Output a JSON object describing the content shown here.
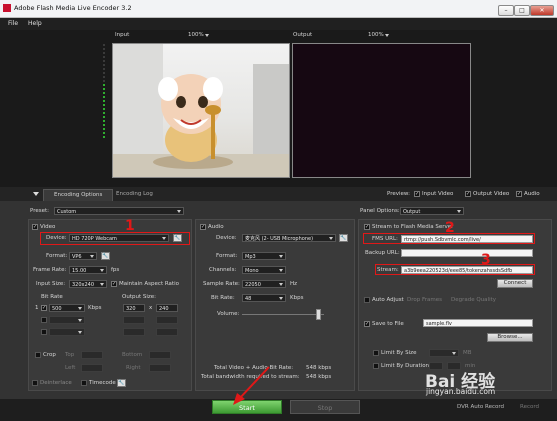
{
  "window": {
    "title": "Adobe Flash Media Live Encoder 3.2",
    "min": "–",
    "max": "□",
    "close": "✕"
  },
  "menu": {
    "file": "File",
    "help": "Help"
  },
  "preview": {
    "input_label": "Input",
    "input_zoom": "100%",
    "output_label": "Output",
    "output_zoom": "100%"
  },
  "tabs": {
    "options": "Encoding Options",
    "log": "Encoding Log"
  },
  "preview_opts": {
    "label": "Preview:",
    "input_video": "Input Video",
    "output_video": "Output Video",
    "audio": "Audio"
  },
  "preset": {
    "label": "Preset:",
    "value": "Custom"
  },
  "panel_options": {
    "label": "Panel Options:",
    "value": "Output"
  },
  "video": {
    "section_label": "Video",
    "device_label": "Device:",
    "device_value": "HD 720P Webcam",
    "format_label": "Format:",
    "format_value": "VP6",
    "frame_rate_label": "Frame Rate:",
    "frame_rate_value": "15.00",
    "fps_unit": "fps",
    "input_size_label": "Input Size:",
    "input_size_value": "320x240",
    "maintain_aspect": "Maintain Aspect Ratio",
    "bitrate_header": "Bit Rate",
    "output_size_header": "Output Size:",
    "row_index": "1",
    "bitrate_value": "500",
    "kbps": "Kbps",
    "out_w": "320",
    "out_h": "240",
    "x_sep": "x",
    "crop_label": "Crop",
    "top_label": "Top",
    "bottom_label": "Bottom",
    "left_label": "Left",
    "right_label": "Right",
    "deinterlace": "Deinterlace",
    "timecode": "Timecode"
  },
  "audio": {
    "section_label": "Audio",
    "device_label": "Device:",
    "device_value": "麦克风 (2- USB Microphone)",
    "format_label": "Format:",
    "format_value": "Mp3",
    "channels_label": "Channels:",
    "channels_value": "Mono",
    "sample_rate_label": "Sample Rate:",
    "sample_rate_value": "22050",
    "hz": "Hz",
    "bitrate_label": "Bit Rate:",
    "bitrate_value": "48",
    "kbps": "Kbps",
    "volume_label": "Volume:"
  },
  "totals": {
    "line1_label": "Total Video + Audio Bit Rate:",
    "line1_value": "548 kbps",
    "line2_label": "Total bandwidth required to stream:",
    "line2_value": "548 kbps"
  },
  "stream": {
    "stream_to_fms": "Stream to Flash Media Server",
    "fms_url_label": "FMS URL:",
    "fms_url_value": "rtmp://push.Sdbvmlc.com/live/",
    "backup_url_label": "Backup URL:",
    "stream_label": "Stream:",
    "stream_value": "a3b9eea220523d/eee85/tokenzahssdsSdfb",
    "connect": "Connect",
    "auto_adjust": "Auto Adjust",
    "drop_frames": "Drop Frames",
    "degrade_quality": "Degrade Quality",
    "save_to_file": "Save to File",
    "file_name": "sample.flv",
    "browse": "Browse...",
    "limit_size": "Limit By Size",
    "size_unit": "MB",
    "limit_duration": "Limit By Duration",
    "duration_unit": "min"
  },
  "annotations": {
    "n1": "1",
    "n2": "2",
    "n3": "3"
  },
  "buttons": {
    "start": "Start",
    "stop": "Stop",
    "dvr_record": "DVR Auto Record",
    "record": "Record"
  },
  "watermark": {
    "brand": "Bai 经验",
    "url": "jingyan.baidu.com"
  }
}
